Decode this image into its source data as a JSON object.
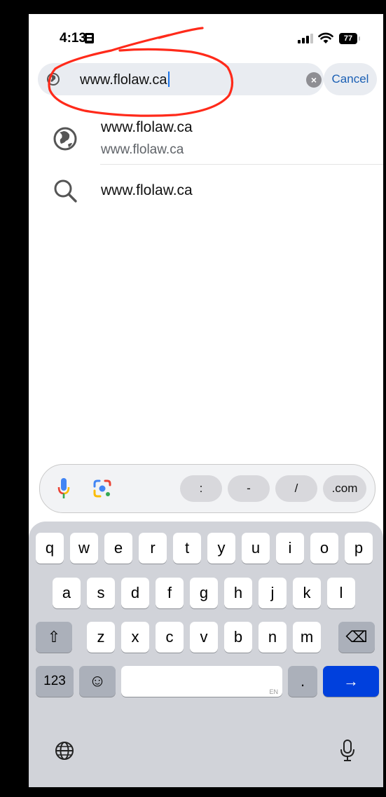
{
  "status_bar": {
    "time": "4:13",
    "battery": "77"
  },
  "search": {
    "url_text": "www.flolaw.ca",
    "clear_glyph": "×",
    "cancel_label": "Cancel"
  },
  "suggestions": [
    {
      "icon": "globe-icon",
      "title": "www.flolaw.ca",
      "subtitle": "www.flolaw.ca"
    },
    {
      "icon": "search-icon",
      "title": "www.flolaw.ca"
    }
  ],
  "accessory": {
    "chips": [
      ":",
      "-",
      "/",
      ".com"
    ]
  },
  "keyboard": {
    "row1": [
      "q",
      "w",
      "e",
      "r",
      "t",
      "y",
      "u",
      "i",
      "o",
      "p"
    ],
    "row2": [
      "a",
      "s",
      "d",
      "f",
      "g",
      "h",
      "j",
      "k",
      "l"
    ],
    "row3": [
      "z",
      "x",
      "c",
      "v",
      "b",
      "n",
      "m"
    ],
    "numbers_label": "123",
    "emoji_label": "☺",
    "space_lang": "EN",
    "period": ".",
    "go_glyph": "→",
    "shift_glyph": "⇧",
    "delete_glyph": "⌫"
  },
  "colors": {
    "accent": "#0040dd",
    "annotation": "#ff2a1a",
    "link": "#1a5fb4"
  }
}
